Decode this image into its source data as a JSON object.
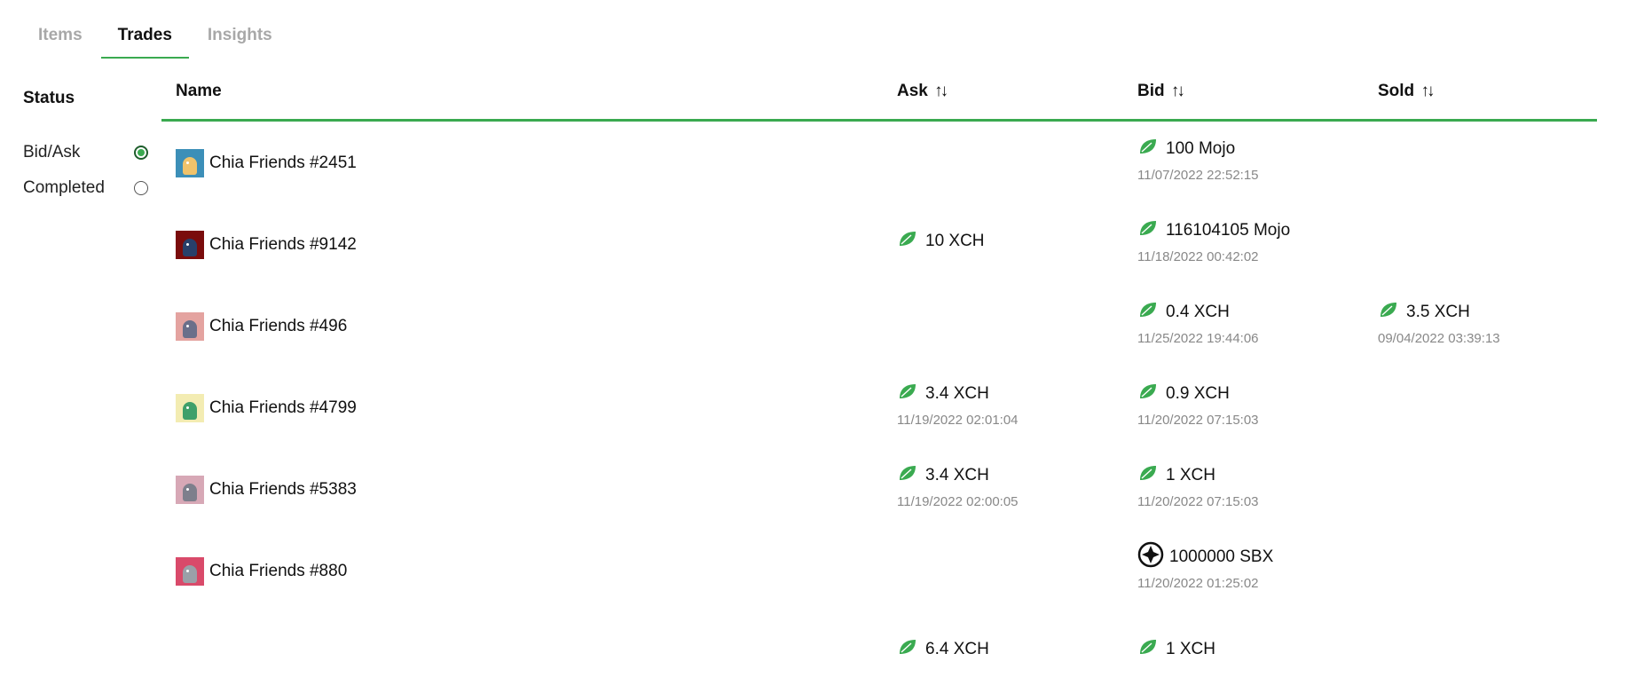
{
  "tabs": [
    "Items",
    "Trades",
    "Insights"
  ],
  "active_tab": "Trades",
  "status": {
    "title": "Status",
    "options": [
      "Bid/Ask",
      "Completed"
    ],
    "selected": "Bid/Ask"
  },
  "columns": {
    "name": "Name",
    "ask": "Ask",
    "bid": "Bid",
    "sold": "Sold",
    "sort_icon": "↑↓"
  },
  "rows": [
    {
      "name": "Chia Friends #2451",
      "thumb_colors": [
        "#3c8fb8",
        "#f0c36b"
      ],
      "ask": null,
      "bid": {
        "price": "100 Mojo",
        "date": "11/07/2022 22:52:15",
        "icon": "leaf-icon"
      },
      "sold": null
    },
    {
      "name": "Chia Friends #9142",
      "thumb_colors": [
        "#7a0c0c",
        "#28406a"
      ],
      "ask": {
        "price": "10 XCH",
        "date": "",
        "icon": "leaf-icon"
      },
      "bid": {
        "price": "116104105 Mojo",
        "date": "11/18/2022 00:42:02",
        "icon": "leaf-icon"
      },
      "sold": null
    },
    {
      "name": "Chia Friends #496",
      "thumb_colors": [
        "#e4a3a0",
        "#6a6f8a"
      ],
      "ask": null,
      "bid": {
        "price": "0.4 XCH",
        "date": "11/25/2022 19:44:06",
        "icon": "leaf-icon"
      },
      "sold": {
        "price": "3.5 XCH",
        "date": "09/04/2022 03:39:13",
        "icon": "leaf-icon"
      }
    },
    {
      "name": "Chia Friends #4799",
      "thumb_colors": [
        "#f3ecb2",
        "#3fa06a"
      ],
      "ask": {
        "price": "3.4 XCH",
        "date": "11/19/2022 02:01:04",
        "icon": "leaf-icon"
      },
      "bid": {
        "price": "0.9 XCH",
        "date": "11/20/2022 07:15:03",
        "icon": "leaf-icon"
      },
      "sold": null
    },
    {
      "name": "Chia Friends #5383",
      "thumb_colors": [
        "#d7a8b6",
        "#7d7f8c"
      ],
      "ask": {
        "price": "3.4 XCH",
        "date": "11/19/2022 02:00:05",
        "icon": "leaf-icon"
      },
      "bid": {
        "price": "1 XCH",
        "date": "11/20/2022 07:15:03",
        "icon": "leaf-icon"
      },
      "sold": null
    },
    {
      "name": "Chia Friends #880",
      "thumb_colors": [
        "#d94a6a",
        "#9aa0a8"
      ],
      "ask": null,
      "bid": {
        "price": "1000000 SBX",
        "date": "11/20/2022 01:25:02",
        "icon": "sbx-icon"
      },
      "sold": null
    },
    {
      "name": "",
      "thumb_colors": null,
      "ask": {
        "price": "6.4 XCH",
        "date": "",
        "icon": "leaf-icon"
      },
      "bid": {
        "price": "1 XCH",
        "date": "",
        "icon": "leaf-icon"
      },
      "sold": null
    }
  ],
  "colors": {
    "accent": "#3aaa50",
    "muted": "#a8a8a8"
  }
}
